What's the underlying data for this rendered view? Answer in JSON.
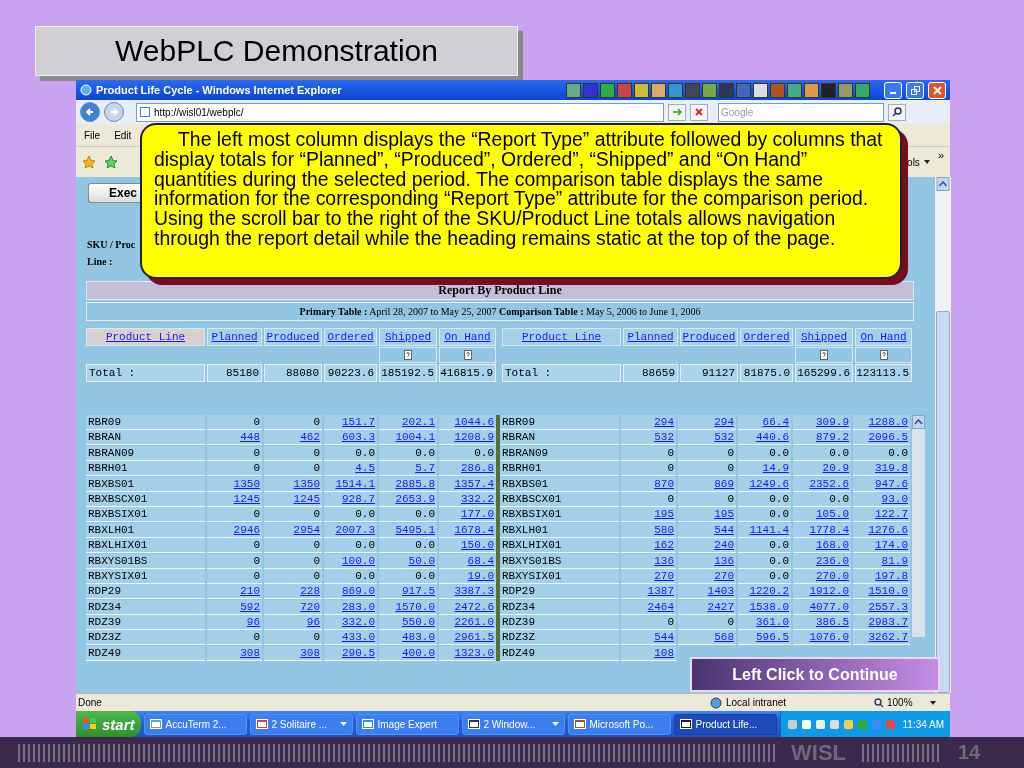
{
  "slide_title": "WebPLC Demonstration",
  "window": {
    "title": "Product Life Cycle - Windows Internet Explorer"
  },
  "address_bar": {
    "url": "http://wisl01/webplc/",
    "search_placeholder": "Google"
  },
  "menu": [
    "File",
    "Edit"
  ],
  "toolbar": {
    "tools_label": "ols",
    "chevron": "»"
  },
  "page": {
    "execute_button": "Exec",
    "filter_label_1": "SKU / Proc",
    "filter_label_2": "Line :"
  },
  "callout": "The left most column displays the “Report Type” attribute followed by columns that display totals for “Planned”, “Produced”, Ordered”, “Shipped” and “On Hand” quantities during the selected period. The comparison table displays the same information for the corresponding “Report Type” attribute for the comparison period. Using the scroll bar to the right of the SKU/Product Line totals allows navigation through the report detail while the heading remains static at the top of the page.",
  "report": {
    "title": "Report By Product Line",
    "subtitle": "**Primary Table :** April 28, 2007 to May 25, 2007 **Comparison Table :** May 5, 2006 to June 1, 2006",
    "tables": [
      {
        "columns": [
          {
            "label": "Product Line",
            "selected": true
          },
          {
            "label": "Planned",
            "selected": false
          },
          {
            "label": "Produced",
            "selected": false
          },
          {
            "label": "Ordered",
            "selected": false
          },
          {
            "label": "Shipped",
            "selected": false,
            "help": true
          },
          {
            "label": "On Hand",
            "selected": false,
            "help": true
          }
        ],
        "total": {
          "label": "Total :",
          "values": [
            "85180",
            "88080",
            "90223.6",
            "185192.5",
            "416815.9"
          ]
        },
        "rows": [
          {
            "name": "RBR09",
            "values": [
              "0",
              "0",
              "151.7",
              "202.1",
              "1044.6"
            ],
            "linked": [
              false,
              false,
              true,
              true,
              true
            ]
          },
          {
            "name": "RBRAN",
            "values": [
              "448",
              "462",
              "603.3",
              "1004.1",
              "1208.9"
            ],
            "linked": [
              true,
              true,
              true,
              true,
              true
            ]
          },
          {
            "name": "RBRAN09",
            "values": [
              "0",
              "0",
              "0.0",
              "0.0",
              "0.0"
            ],
            "linked": [
              false,
              false,
              false,
              false,
              false
            ]
          },
          {
            "name": "RBRH01",
            "values": [
              "0",
              "0",
              "4.5",
              "5.7",
              "286.8"
            ],
            "linked": [
              false,
              false,
              true,
              true,
              true
            ]
          },
          {
            "name": "RBXBS01",
            "values": [
              "1350",
              "1350",
              "1514.1",
              "2885.8",
              "1357.4"
            ],
            "linked": [
              true,
              true,
              true,
              true,
              true
            ]
          },
          {
            "name": "RBXBSCX01",
            "values": [
              "1245",
              "1245",
              "928.7",
              "2653.9",
              "332.2"
            ],
            "linked": [
              true,
              true,
              true,
              true,
              true
            ]
          },
          {
            "name": "RBXBSIX01",
            "values": [
              "0",
              "0",
              "0.0",
              "0.0",
              "177.0"
            ],
            "linked": [
              false,
              false,
              false,
              false,
              true
            ]
          },
          {
            "name": "RBXLH01",
            "values": [
              "2946",
              "2954",
              "2007.3",
              "5495.1",
              "1678.4"
            ],
            "linked": [
              true,
              true,
              true,
              true,
              true
            ]
          },
          {
            "name": "RBXLHIX01",
            "values": [
              "0",
              "0",
              "0.0",
              "0.0",
              "150.0"
            ],
            "linked": [
              false,
              false,
              false,
              false,
              true
            ]
          },
          {
            "name": "RBXYS01BS",
            "values": [
              "0",
              "0",
              "100.0",
              "50.0",
              "68.4"
            ],
            "linked": [
              false,
              false,
              true,
              true,
              true
            ]
          },
          {
            "name": "RBXYSIX01",
            "values": [
              "0",
              "0",
              "0.0",
              "0.0",
              "19.0"
            ],
            "linked": [
              false,
              false,
              false,
              false,
              true
            ]
          },
          {
            "name": "RDP29",
            "values": [
              "210",
              "228",
              "869.0",
              "917.5",
              "3387.3"
            ],
            "linked": [
              true,
              true,
              true,
              true,
              true
            ]
          },
          {
            "name": "RDZ34",
            "values": [
              "592",
              "720",
              "283.0",
              "1570.0",
              "2472.6"
            ],
            "linked": [
              true,
              true,
              true,
              true,
              true
            ]
          },
          {
            "name": "RDZ39",
            "values": [
              "96",
              "96",
              "332.0",
              "550.0",
              "2261.0"
            ],
            "linked": [
              true,
              true,
              true,
              true,
              true
            ]
          },
          {
            "name": "RDZ3Z",
            "values": [
              "0",
              "0",
              "433.0",
              "483.0",
              "2961.5"
            ],
            "linked": [
              false,
              false,
              true,
              true,
              true
            ]
          },
          {
            "name": "RDZ49",
            "values": [
              "308",
              "308",
              "290.5",
              "400.0",
              "1323.0"
            ],
            "linked": [
              true,
              true,
              true,
              true,
              true
            ]
          }
        ]
      },
      {
        "columns": [
          {
            "label": "Product Line",
            "selected": false
          },
          {
            "label": "Planned",
            "selected": false
          },
          {
            "label": "Produced",
            "selected": false
          },
          {
            "label": "Ordered",
            "selected": false
          },
          {
            "label": "Shipped",
            "selected": false,
            "help": true
          },
          {
            "label": "On Hand",
            "selected": false,
            "help": true
          }
        ],
        "total": {
          "label": "Total :",
          "values": [
            "88659",
            "91127",
            "81875.0",
            "165299.6",
            "123113.5"
          ]
        },
        "rows": [
          {
            "name": "RBR09",
            "values": [
              "294",
              "294",
              "66.4",
              "309.9",
              "1288.0"
            ],
            "linked": [
              true,
              true,
              true,
              true,
              true
            ]
          },
          {
            "name": "RBRAN",
            "values": [
              "532",
              "532",
              "440.6",
              "879.2",
              "2096.5"
            ],
            "linked": [
              true,
              true,
              true,
              true,
              true
            ]
          },
          {
            "name": "RBRAN09",
            "values": [
              "0",
              "0",
              "0.0",
              "0.0",
              "0.0"
            ],
            "linked": [
              false,
              false,
              false,
              false,
              false
            ]
          },
          {
            "name": "RBRH01",
            "values": [
              "0",
              "0",
              "14.9",
              "20.9",
              "319.8"
            ],
            "linked": [
              false,
              false,
              true,
              true,
              true
            ]
          },
          {
            "name": "RBXBS01",
            "values": [
              "870",
              "869",
              "1249.6",
              "2352.6",
              "947.6"
            ],
            "linked": [
              true,
              true,
              true,
              true,
              true
            ]
          },
          {
            "name": "RBXBSCX01",
            "values": [
              "0",
              "0",
              "0.0",
              "0.0",
              "93.0"
            ],
            "linked": [
              false,
              false,
              false,
              false,
              true
            ]
          },
          {
            "name": "RBXBSIX01",
            "values": [
              "195",
              "195",
              "0.0",
              "105.0",
              "122.7"
            ],
            "linked": [
              true,
              true,
              false,
              true,
              true
            ]
          },
          {
            "name": "RBXLH01",
            "values": [
              "580",
              "544",
              "1141.4",
              "1778.4",
              "1276.6"
            ],
            "linked": [
              true,
              true,
              true,
              true,
              true
            ]
          },
          {
            "name": "RBXLHIX01",
            "values": [
              "162",
              "240",
              "0.0",
              "168.0",
              "174.0"
            ],
            "linked": [
              true,
              true,
              false,
              true,
              true
            ]
          },
          {
            "name": "RBXYS01BS",
            "values": [
              "136",
              "136",
              "0.0",
              "236.0",
              "81.9"
            ],
            "linked": [
              true,
              true,
              false,
              true,
              true
            ]
          },
          {
            "name": "RBXYSIX01",
            "values": [
              "270",
              "270",
              "0.0",
              "270.0",
              "197.8"
            ],
            "linked": [
              true,
              true,
              false,
              true,
              true
            ]
          },
          {
            "name": "RDP29",
            "values": [
              "1387",
              "1403",
              "1220.2",
              "1912.0",
              "1510.0"
            ],
            "linked": [
              true,
              true,
              true,
              true,
              true
            ]
          },
          {
            "name": "RDZ34",
            "values": [
              "2464",
              "2427",
              "1538.0",
              "4077.0",
              "2557.3"
            ],
            "linked": [
              true,
              true,
              true,
              true,
              true
            ]
          },
          {
            "name": "RDZ39",
            "values": [
              "0",
              "0",
              "361.0",
              "386.5",
              "2983.7"
            ],
            "linked": [
              false,
              false,
              true,
              true,
              true
            ]
          },
          {
            "name": "RDZ3Z",
            "values": [
              "544",
              "568",
              "596.5",
              "1076.0",
              "3262.7"
            ],
            "linked": [
              true,
              true,
              true,
              true,
              true
            ]
          },
          {
            "name": "RDZ49",
            "values": [
              "108"
            ],
            "linked": [
              true
            ]
          }
        ]
      }
    ]
  },
  "status_bar": {
    "status": "Done",
    "zone": "Local intranet",
    "zoom": "100%"
  },
  "taskbar": {
    "start": "start",
    "clock": "11:34 AM",
    "items": [
      {
        "label": "AccuTerm 2...",
        "selected": false
      },
      {
        "label": "2 Solitaire ...",
        "selected": false,
        "menu": true
      },
      {
        "label": "Image Expert",
        "selected": false
      },
      {
        "label": "2 Window...",
        "selected": false,
        "menu": true
      },
      {
        "label": "Microsoft Po...",
        "selected": false
      },
      {
        "label": "Product Life...",
        "selected": true
      }
    ]
  },
  "continue_button": "Left Click to Continue",
  "footer": {
    "brand": "WISL",
    "page_number": "14"
  }
}
